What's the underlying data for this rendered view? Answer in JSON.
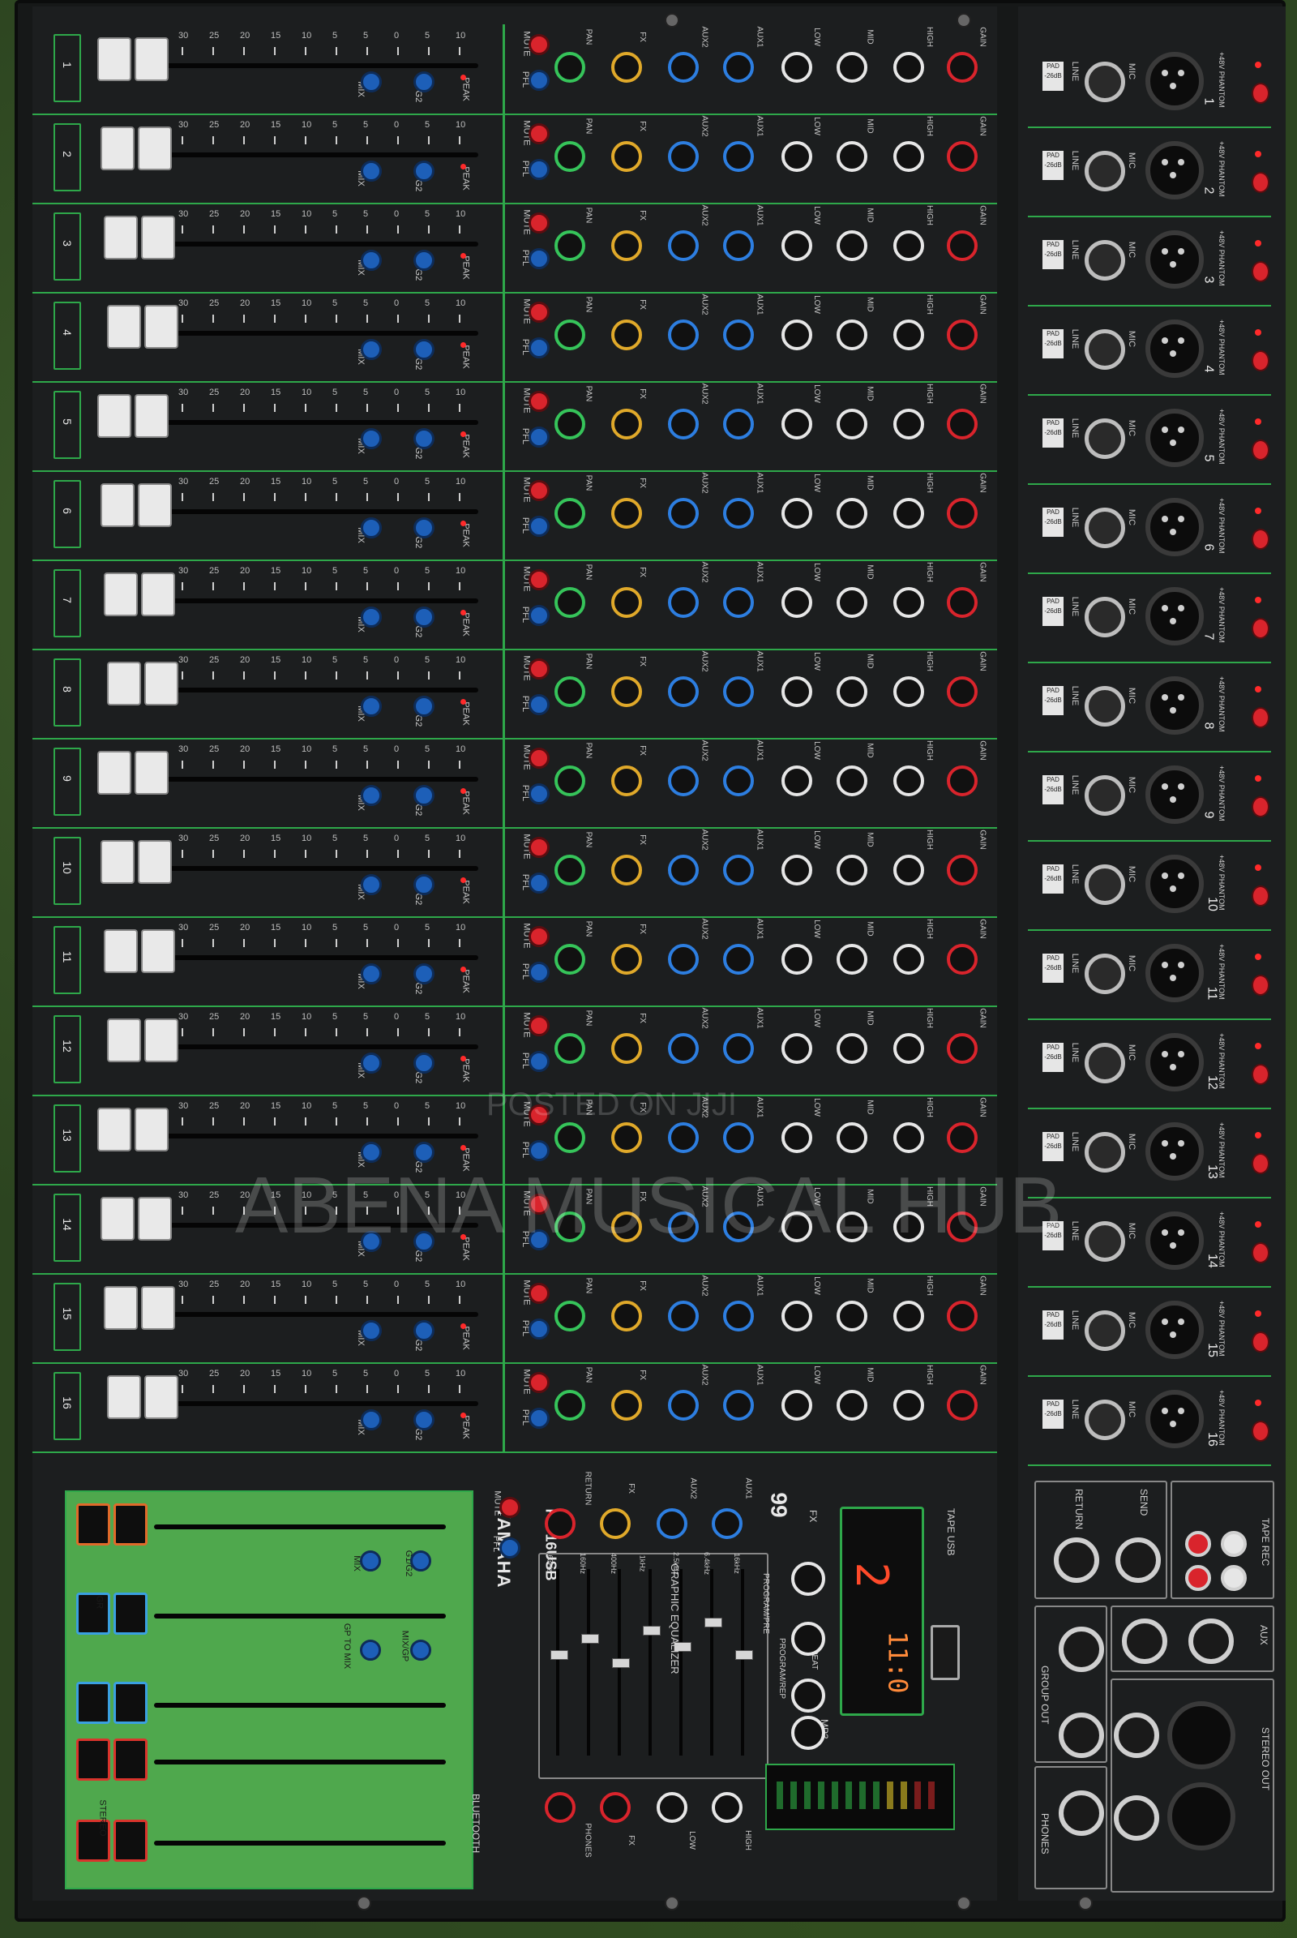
{
  "product": {
    "brand": "YAMAHA",
    "model": "PK-16USB",
    "bluetooth_label": "BLUETOOTH"
  },
  "watermark": {
    "line1": "POSTED ON JIJI",
    "line2": "ABENA MUSICAL HUB"
  },
  "channels": {
    "numbers": [
      "1",
      "2",
      "3",
      "4",
      "5",
      "6",
      "7",
      "8",
      "9",
      "10",
      "11",
      "12",
      "13",
      "14",
      "15",
      "16"
    ],
    "strip_labels": [
      "MUTE",
      "PFL",
      "PAN",
      "FX",
      "AUX2",
      "AUX1",
      "LOW",
      "MID",
      "HIGH",
      "GAIN",
      "MIX",
      "G1/G2",
      "PEAK"
    ],
    "fader_scale": [
      "30",
      "25",
      "20",
      "15",
      "10",
      "5",
      "5",
      "0",
      "5",
      "10"
    ]
  },
  "inputs": {
    "labels": [
      "PAD -26dB",
      "LINE",
      "MIC",
      "+48V PHANTOM"
    ]
  },
  "master": {
    "labels": [
      "MUTE",
      "PFL",
      "RETURN",
      "FX",
      "AUX2",
      "AUX1",
      "MIX",
      "G1/G2",
      "GR",
      "GP TO MIX",
      "MIX/GP",
      "STEREO"
    ],
    "bottom_knobs": [
      "PHONES",
      "FX",
      "LOW",
      "HIGH"
    ]
  },
  "geq": {
    "title": "GRAPHIC EQUALIZER",
    "bands": [
      "63Hz",
      "160Hz",
      "400Hz",
      "1kHz",
      "2.5kHz",
      "6.4kHz",
      "16kHz"
    ]
  },
  "fx_section": {
    "number": "99",
    "fx_label": "FX",
    "display_preset": "2",
    "mp3_time": "11:0",
    "mp3_label": "MP3",
    "program_labels": [
      "PROGRAM/PRE",
      "PROGRAM/REP",
      "REC",
      "REPEAT"
    ],
    "tape_usb": "TAPE USB"
  },
  "rear": {
    "return": "RETURN",
    "send": "SEND",
    "tape_rec": "TAPE REC",
    "aux": "AUX",
    "group_out": "GROUP OUT",
    "stereo_out": "STEREO OUT",
    "phones": "PHONES"
  },
  "colors": {
    "panel": "#1c1e1f",
    "accent_green": "#2ea84a",
    "master_green": "#4fa84d",
    "mute_red": "#d9242c",
    "pfl_blue": "#1d5fb8",
    "pan_green": "#36c45a",
    "fx_yellow": "#e0a92a"
  }
}
